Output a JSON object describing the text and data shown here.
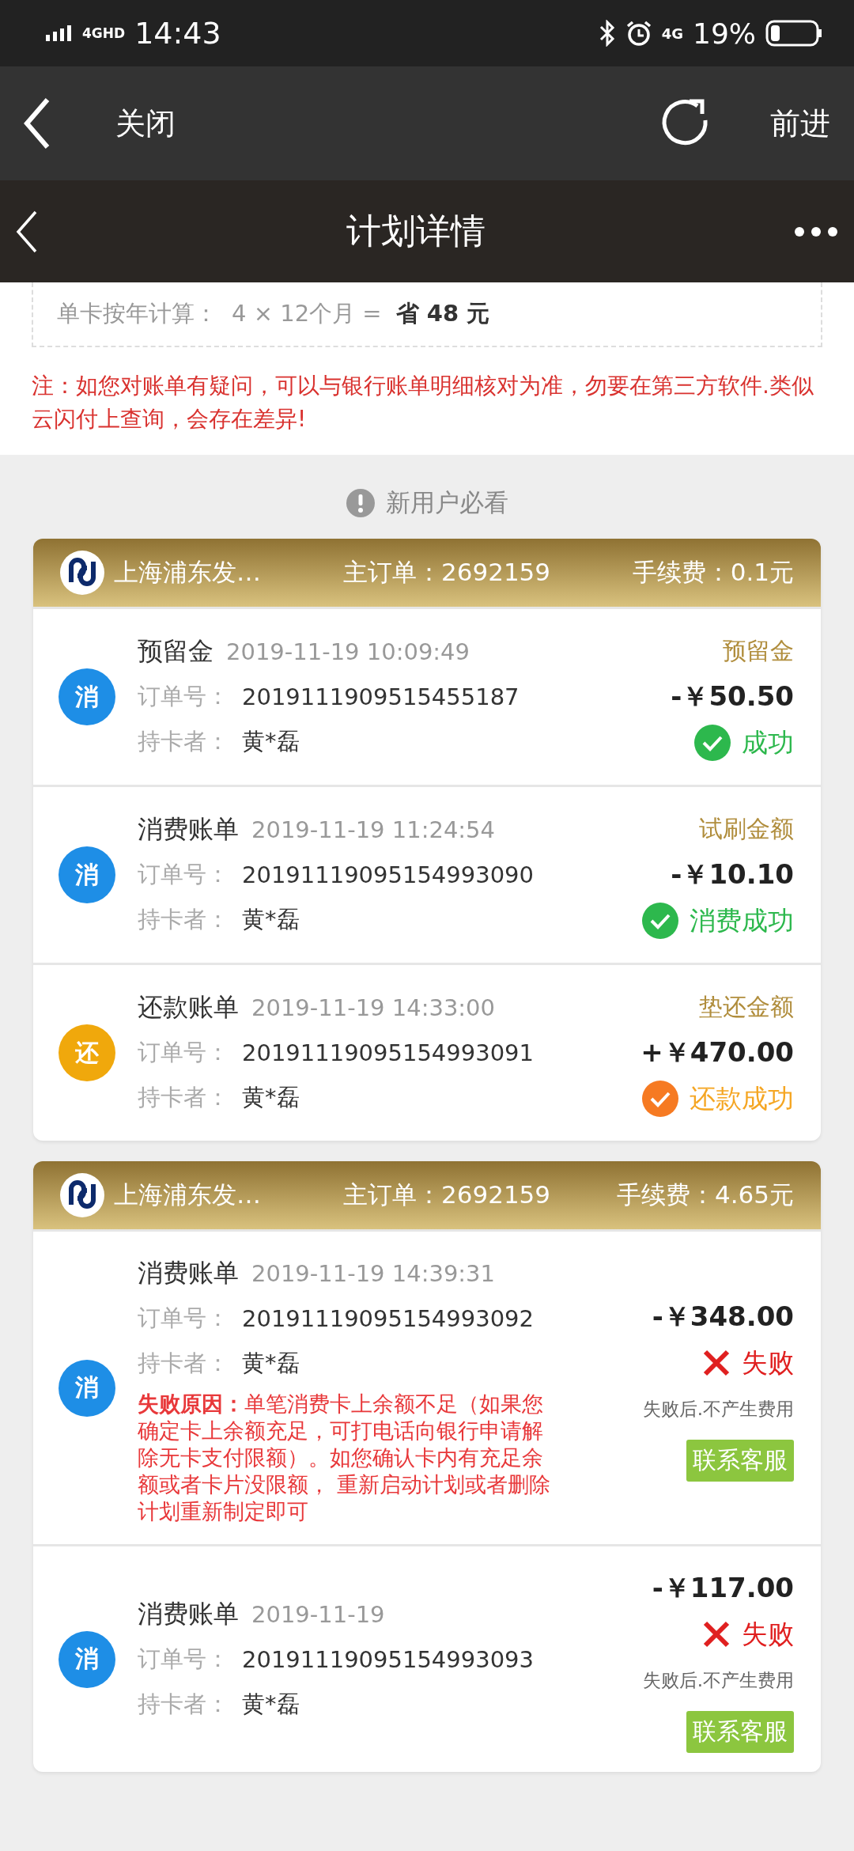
{
  "status_bar": {
    "network": "4GHD",
    "time": "14:43",
    "data": "4G",
    "battery": "19%"
  },
  "browser_bar": {
    "close": "关闭",
    "forward": "前进"
  },
  "header": {
    "title": "计划详情"
  },
  "savings": {
    "label": "单卡按年计算：",
    "formula": "4 × 12个月 =",
    "result": "省 48 元"
  },
  "note": "注：如您对账单有疑问，可以与银行账单明细核对为准，勿要在第三方软件.类似云闪付上查询，会存在差异!",
  "notice": "新用户必看",
  "groups": [
    {
      "bank": "上海浦东发…",
      "main_order_label": "主订单：",
      "main_order": "2692159",
      "fee_label": "手续费：",
      "fee": "0.1元",
      "rows": [
        {
          "kind": "consume",
          "badge": "消",
          "title": "预留金",
          "time": "2019-11-19 10:09:49",
          "order_label": "订单号：",
          "order_no": "2019111909515455187",
          "holder_label": "持卡者：",
          "holder": "黄*磊",
          "amount_label": "预留金",
          "amount": "-￥50.50",
          "status": {
            "kind": "success",
            "text": "成功"
          }
        },
        {
          "kind": "consume",
          "badge": "消",
          "title": "消费账单",
          "time": "2019-11-19 11:24:54",
          "order_label": "订单号：",
          "order_no": "20191119095154993090",
          "holder_label": "持卡者：",
          "holder": "黄*磊",
          "amount_label": "试刷金额",
          "amount": "-￥10.10",
          "status": {
            "kind": "success",
            "text": "消费成功"
          }
        },
        {
          "kind": "repay",
          "badge": "还",
          "title": "还款账单",
          "time": "2019-11-19 14:33:00",
          "order_label": "订单号：",
          "order_no": "20191119095154993091",
          "holder_label": "持卡者：",
          "holder": "黄*磊",
          "amount_label": "垫还金额",
          "amount": "+￥470.00",
          "status": {
            "kind": "repaid",
            "text": "还款成功"
          }
        }
      ]
    },
    {
      "bank": "上海浦东发…",
      "main_order_label": "主订单：",
      "main_order": "2692159",
      "fee_label": "手续费：",
      "fee": "4.65元",
      "rows": [
        {
          "kind": "consume",
          "badge": "消",
          "title": "消费账单",
          "time": "2019-11-19 14:39:31",
          "order_label": "订单号：",
          "order_no": "20191119095154993092",
          "holder_label": "持卡者：",
          "holder": "黄*磊",
          "reason": "**失败原因：**单笔消费卡上余额不足（如果您确定卡上余额充足，可打电话向银行申请解除无卡支付限额）。如您确认卡内有充足余额或者卡片没限额， 重新启动计划或者删除计划重新制定即可",
          "amount": "-￥348.00",
          "status": {
            "kind": "failed",
            "text": "失败"
          },
          "fail_note": "失败后.不产生费用",
          "contact": "联系客服"
        },
        {
          "kind": "consume",
          "badge": "消",
          "title": "消费账单",
          "time": "2019-11-19",
          "order_label": "订单号：",
          "order_no": "20191119095154993093",
          "holder_label": "持卡者：",
          "holder": "黄*磊",
          "amount": "-￥117.00",
          "status": {
            "kind": "failed",
            "text": "失败"
          },
          "fail_note": "失败后.不产生费用",
          "contact": "联系客服"
        }
      ]
    }
  ]
}
